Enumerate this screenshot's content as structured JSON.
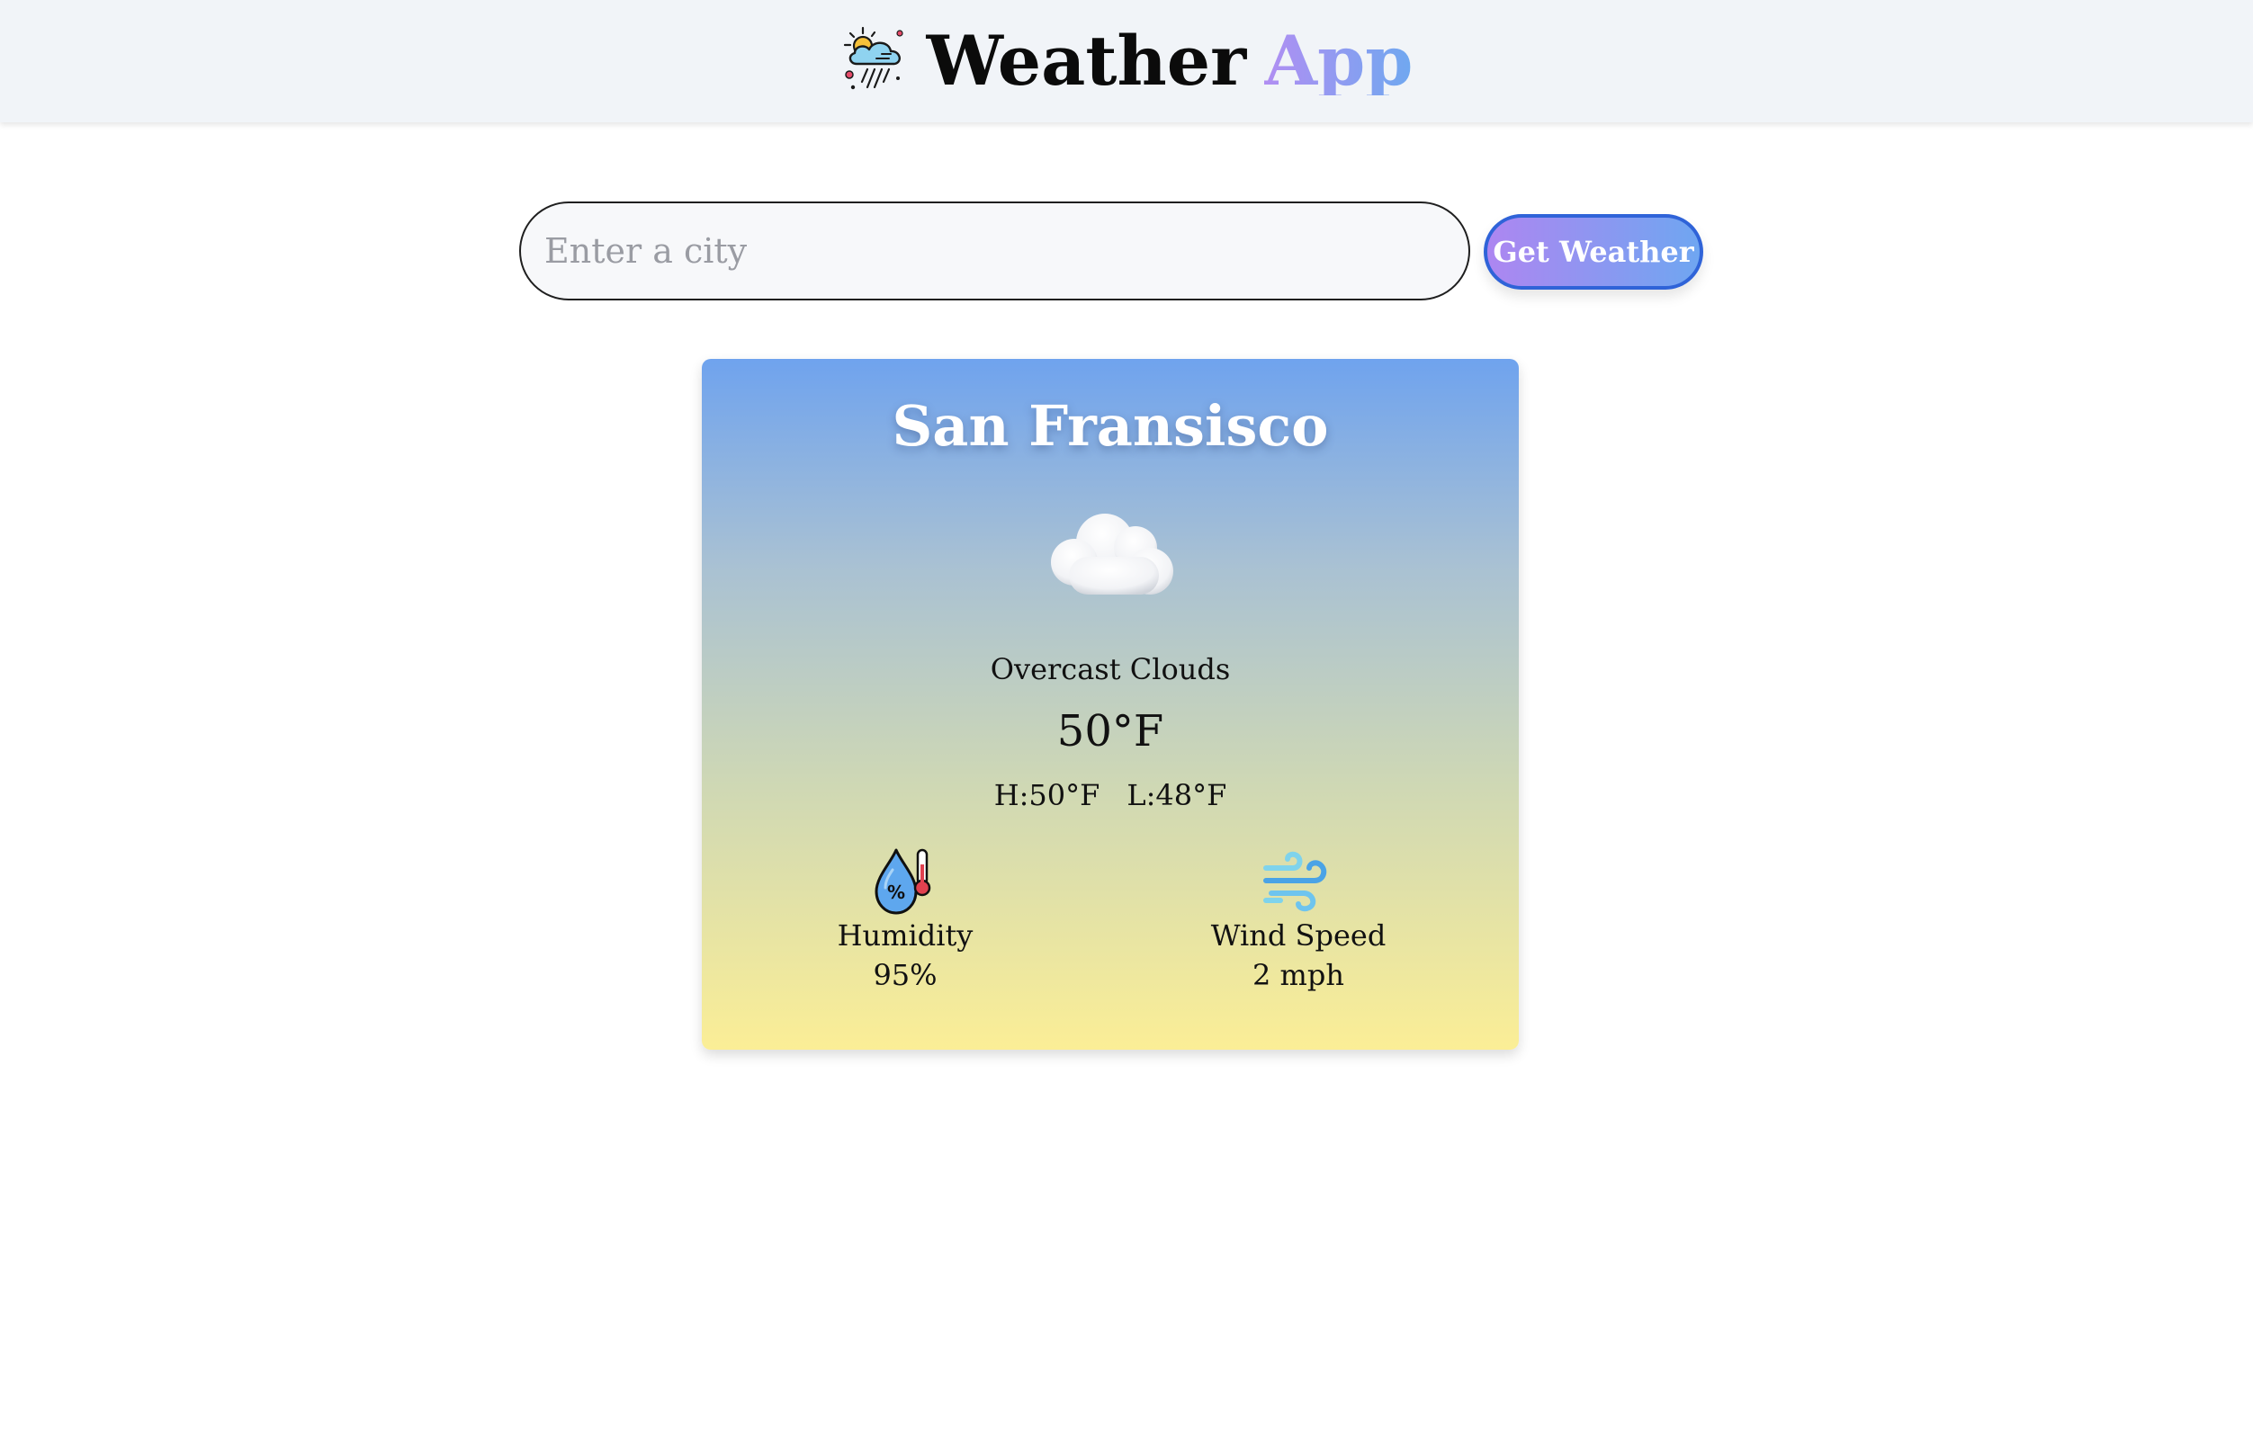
{
  "header": {
    "logo_icon": "weather-rain-cloud-icon",
    "title": "Weather",
    "title_accent": "App",
    "accent_gradient": [
      "#b18ef2",
      "#6fa8f0"
    ]
  },
  "search": {
    "placeholder": "Enter a city",
    "value": "",
    "button_label": "Get Weather"
  },
  "card": {
    "city": "San Fransisco",
    "condition_icon": "cloud-icon",
    "condition": "Overcast Clouds",
    "temperature": "50°F",
    "high": "H:50°F",
    "low": "L:48°F",
    "humidity": {
      "icon": "humidity-drop-icon",
      "label": "Humidity",
      "value": "95%"
    },
    "wind": {
      "icon": "wind-icon",
      "label": "Wind Speed",
      "value": "2 mph"
    },
    "gradient": [
      "#6fa3ee",
      "#fbee96"
    ]
  }
}
